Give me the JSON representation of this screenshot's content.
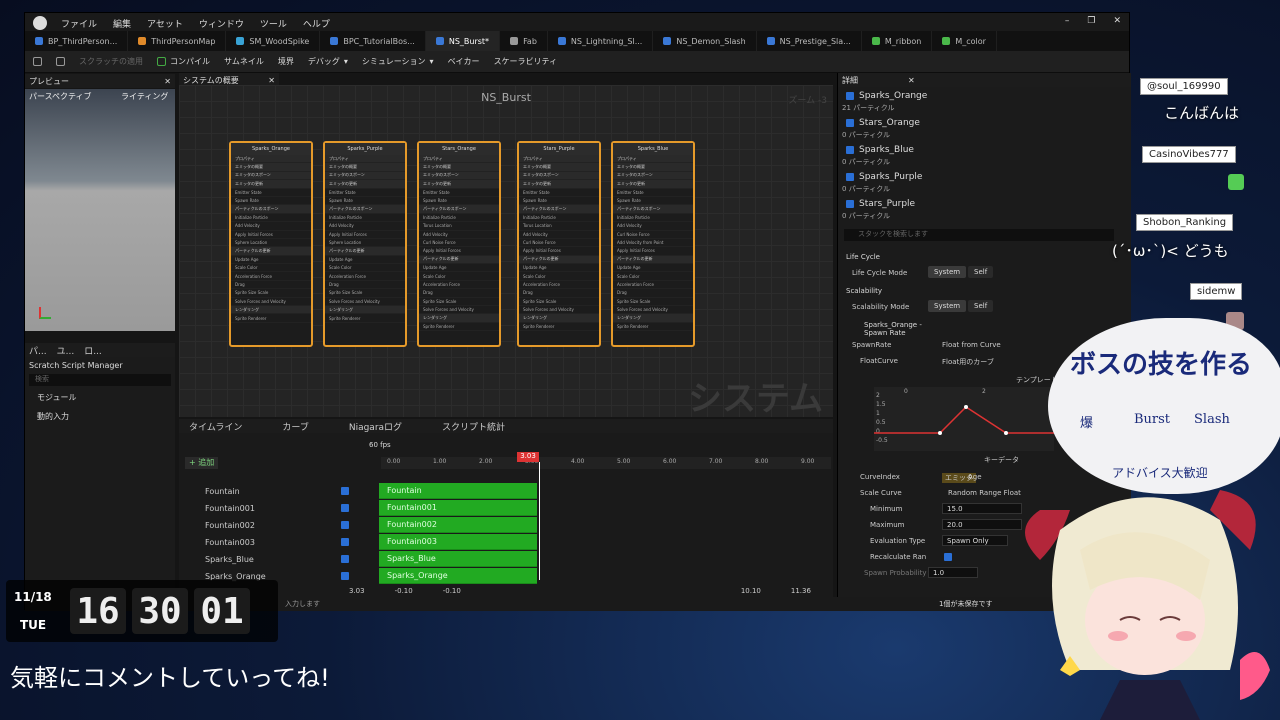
{
  "menu": [
    "ファイル",
    "編集",
    "アセット",
    "ウィンドウ",
    "ツール",
    "ヘルプ"
  ],
  "tabs": [
    {
      "label": "BP_ThirdPerson...",
      "color": "#3a78d6"
    },
    {
      "label": "ThirdPersonMap",
      "color": "#e08a2a"
    },
    {
      "label": "SM_WoodSpike",
      "color": "#39a3d6"
    },
    {
      "label": "BPC_TutorialBos...",
      "color": "#3a78d6"
    },
    {
      "label": "NS_Burst*",
      "color": "#3a78d6"
    },
    {
      "label": "Fab",
      "color": "#999999"
    },
    {
      "label": "NS_Lightning_Sl...",
      "color": "#3a78d6"
    },
    {
      "label": "NS_Demon_Slash",
      "color": "#3a78d6"
    },
    {
      "label": "NS_Prestige_Sla...",
      "color": "#3a78d6"
    },
    {
      "label": "M_ribbon",
      "color": "#4ab84a"
    },
    {
      "label": "M_color",
      "color": "#4ab84a"
    }
  ],
  "toolbar": [
    "スクラッチの適用",
    "コンパイル",
    "サムネイル",
    "境界",
    "デバッグ",
    "シミュレーション",
    "ベイカー",
    "スケーラビリティ"
  ],
  "panels": {
    "preview": "プレビュー",
    "perspective": "パースペクティブ",
    "lighting": "ライティング",
    "overview": "システムの概要",
    "graph_title": "NS_Burst",
    "zoom": "ズーム -3",
    "watermark": "システム",
    "details": "詳細",
    "timeline": "タイムライン",
    "curves": "カーブ",
    "log": "Niagaraログ",
    "script_stats": "スクリプト統計"
  },
  "scratch": {
    "title": "Scratch Script Manager",
    "search": "検索",
    "items": [
      "モジュール",
      "動的入力"
    ],
    "tabs": [
      "パ...",
      "ユ...",
      "ロ..."
    ]
  },
  "emitters": [
    {
      "name": "Sparks_Orange",
      "rows": [
        "プロパティ",
        "エミッタの概要",
        "エミッタのスポーン",
        "エミッタの更新",
        "Emitter State",
        "Spawn Rate",
        "パーティクルのスポーン",
        "Initialize Particle",
        "Add Velocity",
        "Apply Initial Forces",
        "Sphere Location",
        "パーティクルの更新",
        "Update Age",
        "Scale Color",
        "Acceleration Force",
        "Drag",
        "Sprite Size Scale",
        "Solve Forces and Velocity",
        "レンダリング",
        "Sprite Renderer"
      ]
    },
    {
      "name": "Sparks_Purple",
      "rows": [
        "プロパティ",
        "エミッタの概要",
        "エミッタのスポーン",
        "エミッタの更新",
        "Emitter State",
        "Spawn Rate",
        "パーティクルのスポーン",
        "Initialize Particle",
        "Add Velocity",
        "Apply Initial Forces",
        "Sphere Location",
        "パーティクルの更新",
        "Update Age",
        "Scale Color",
        "Acceleration Force",
        "Drag",
        "Sprite Size Scale",
        "Solve Forces and Velocity",
        "レンダリング",
        "Sprite Renderer"
      ]
    },
    {
      "name": "Stars_Orange",
      "rows": [
        "プロパティ",
        "エミッタの概要",
        "エミッタのスポーン",
        "エミッタの更新",
        "Emitter State",
        "Spawn Rate",
        "パーティクルのスポーン",
        "Initialize Particle",
        "Torus Location",
        "Add Velocity",
        "Curl Noise Force",
        "Apply Initial Forces",
        "パーティクルの更新",
        "Update Age",
        "Scale Color",
        "Acceleration Force",
        "Drag",
        "Sprite Size Scale",
        "Solve Forces and Velocity",
        "レンダリング",
        "Sprite Renderer"
      ]
    },
    {
      "name": "Stars_Purple",
      "rows": [
        "プロパティ",
        "エミッタの概要",
        "エミッタのスポーン",
        "エミッタの更新",
        "Emitter State",
        "Spawn Rate",
        "パーティクルのスポーン",
        "Initialize Particle",
        "Torus Location",
        "Add Velocity",
        "Curl Noise Force",
        "Apply Initial Forces",
        "パーティクルの更新",
        "Update Age",
        "Scale Color",
        "Acceleration Force",
        "Drag",
        "Sprite Size Scale",
        "Solve Forces and Velocity",
        "レンダリング",
        "Sprite Renderer"
      ]
    },
    {
      "name": "Sparks_Blue",
      "rows": [
        "プロパティ",
        "エミッタの概要",
        "エミッタのスポーン",
        "エミッタの更新",
        "Emitter State",
        "Spawn Rate",
        "パーティクルのスポーン",
        "Initialize Particle",
        "Add Velocity",
        "Curl Noise Force",
        "Add Velocity from Point",
        "Apply Initial Forces",
        "パーティクルの更新",
        "Update Age",
        "Scale Color",
        "Acceleration Force",
        "Drag",
        "Sprite Size Scale",
        "Solve Forces and Velocity",
        "レンダリング",
        "Sprite Renderer"
      ]
    }
  ],
  "timeline": {
    "add": "追加",
    "fps": "60 fps",
    "time": "3.03",
    "ticks": [
      "0.00",
      "1.00",
      "2.00",
      "3.00",
      "4.00",
      "5.00",
      "6.00",
      "7.00",
      "8.00",
      "9.00"
    ],
    "tracks": [
      "Fountain",
      "Fountain001",
      "Fountain002",
      "Fountain003",
      "Sparks_Blue",
      "Sparks_Orange"
    ],
    "bottom": [
      "3.03",
      "-0.10",
      "-0.10",
      "10.10",
      "11.36"
    ]
  },
  "details": {
    "emitters": [
      {
        "name": "Sparks_Orange",
        "count": "21 パーティクル"
      },
      {
        "name": "Stars_Orange",
        "count": "0 パーティクル"
      },
      {
        "name": "Sparks_Blue",
        "count": "0 パーティクル"
      },
      {
        "name": "Sparks_Purple",
        "count": "0 パーティクル"
      },
      {
        "name": "Stars_Purple",
        "count": "0 パーティクル"
      }
    ],
    "search": "スタックを検索します",
    "life_cycle": "Life Cycle",
    "life_cycle_mode": "Life Cycle Mode",
    "scalability": "Scalability",
    "scalability_mode": "Scalability Mode",
    "system": "System",
    "self": "Self",
    "spawn_hdr": "Sparks_Orange - Spawn Rate",
    "spawn_rate": "SpawnRate",
    "float_from_curve": "Float from Curve",
    "float_curve": "FloatCurve",
    "float_curve_val": "Float用のカーブ",
    "template": "テンプレート",
    "keydata": "キーデータ",
    "curve_ticks": [
      "2",
      "1.5",
      "1",
      "0.5",
      "0",
      "-0.5"
    ],
    "curve_x": [
      "0",
      "2"
    ],
    "curve_index": "CurveIndex",
    "emitter_tag": "エミッタ",
    "age": "Age",
    "scale_curve": "Scale Curve",
    "random_range": "Random Range Float",
    "minimum": "Minimum",
    "min_val": "15.0",
    "maximum": "Maximum",
    "max_val": "20.0",
    "eval_type": "Evaluation Type",
    "spawn_only": "Spawn Only",
    "recalc": "Recalculate Ran",
    "spawn_prob": "Spawn Probability",
    "spawn_prob_val": "1.0",
    "unsaved": "1個が未保存です"
  },
  "status": {
    "hint": "入力します"
  },
  "chat": {
    "users": [
      "@soul_169990",
      "CasinoVibes777",
      "Shobon_Ranking",
      "sidemw"
    ],
    "msgs": [
      "こんばんは",
      "(´･ω･`)< どうも"
    ]
  },
  "clock": {
    "date": "11/18",
    "day": "TUE",
    "digits": [
      "16",
      "30",
      "01"
    ]
  },
  "bubble": {
    "l1": "ボスの技を作る",
    "l2a": "爆",
    "l2b": "Burst",
    "l2c": "Slash",
    "l3": "アドバイス大歓迎"
  },
  "message": "気軽にコメントしていってね!"
}
